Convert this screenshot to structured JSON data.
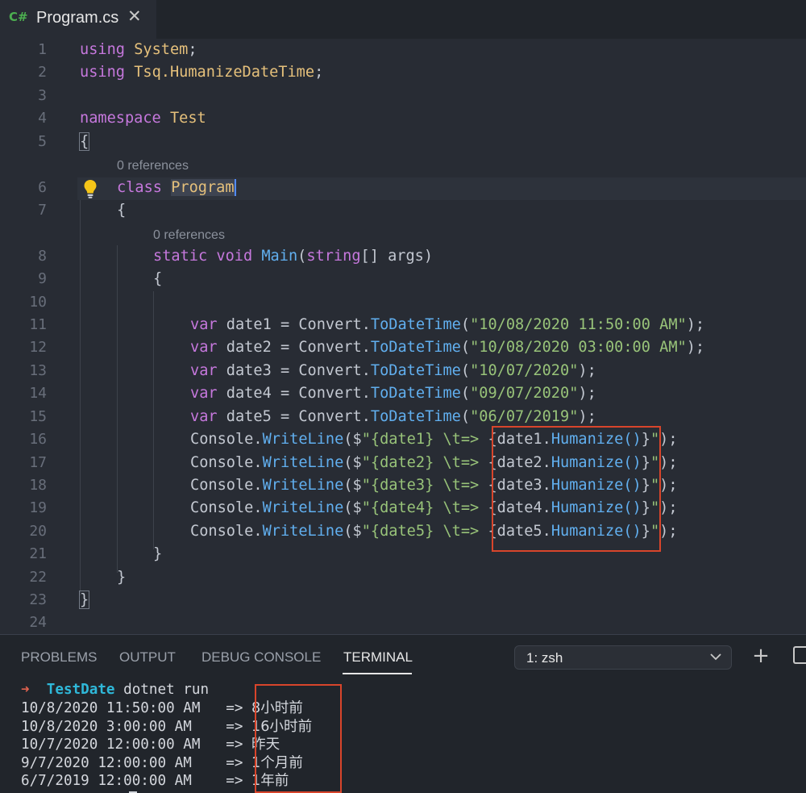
{
  "tab": {
    "icon": "C#",
    "title": "Program.cs"
  },
  "editor": {
    "codelens1": "0 references",
    "codelens2": "0 references",
    "line_numbers": [
      "1",
      "2",
      "3",
      "4",
      "5",
      "6",
      "7",
      "8",
      "9",
      "10",
      "11",
      "12",
      "13",
      "14",
      "15",
      "16",
      "17",
      "18",
      "19",
      "20",
      "21",
      "22",
      "23",
      "24"
    ],
    "code": {
      "l1": {
        "kw": "using",
        "ns": "System",
        "end": ";"
      },
      "l2": {
        "kw": "using",
        "ns": "Tsq.HumanizeDateTime",
        "end": ";"
      },
      "l4": {
        "kw": "namespace",
        "ns": "Test"
      },
      "l5": "{",
      "l6": {
        "kw": "class",
        "name": "Program"
      },
      "l7": "{",
      "l8": {
        "kw": "static",
        "kw2": "void",
        "fn": "Main",
        "p1": "(",
        "type": "string",
        "rest": "[] args)"
      },
      "l9": "{",
      "vars": [
        {
          "kw": "var",
          "name": " date1 = Convert.",
          "fn": "ToDateTime",
          "str": "\"10/08/2020 11:50:00 AM\"",
          "end": ");"
        },
        {
          "kw": "var",
          "name": " date2 = Convert.",
          "fn": "ToDateTime",
          "str": "\"10/08/2020 03:00:00 AM\"",
          "end": ");"
        },
        {
          "kw": "var",
          "name": " date3 = Convert.",
          "fn": "ToDateTime",
          "str": "\"10/07/2020\"",
          "end": ");"
        },
        {
          "kw": "var",
          "name": " date4 = Convert.",
          "fn": "ToDateTime",
          "str": "\"09/07/2020\"",
          "end": ");"
        },
        {
          "kw": "var",
          "name": " date5 = Convert.",
          "fn": "ToDateTime",
          "str": "\"06/07/2019\"",
          "end": ");"
        }
      ],
      "writes": [
        {
          "obj": "Console.",
          "fn": "WriteLine",
          "open": "($",
          "s1": "\"{date1} \\t=> ",
          "arg": "{date1.",
          "call": "Humanize()",
          "close": "}",
          "s2": "\"",
          "end": ");"
        },
        {
          "obj": "Console.",
          "fn": "WriteLine",
          "open": "($",
          "s1": "\"{date2} \\t=> ",
          "arg": "{date2.",
          "call": "Humanize()",
          "close": "}",
          "s2": "\"",
          "end": ");"
        },
        {
          "obj": "Console.",
          "fn": "WriteLine",
          "open": "($",
          "s1": "\"{date3} \\t=> ",
          "arg": "{date3.",
          "call": "Humanize()",
          "close": "}",
          "s2": "\"",
          "end": ");"
        },
        {
          "obj": "Console.",
          "fn": "WriteLine",
          "open": "($",
          "s1": "\"{date4} \\t=> ",
          "arg": "{date4.",
          "call": "Humanize()",
          "close": "}",
          "s2": "\"",
          "end": ");"
        },
        {
          "obj": "Console.",
          "fn": "WriteLine",
          "open": "($",
          "s1": "\"{date5} \\t=> ",
          "arg": "{date5.",
          "call": "Humanize()",
          "close": "}",
          "s2": "\"",
          "end": ");"
        }
      ],
      "l21": "}",
      "l22": "}",
      "l23": "}"
    }
  },
  "panel": {
    "tabs": [
      "PROBLEMS",
      "OUTPUT",
      "DEBUG CONSOLE",
      "TERMINAL"
    ],
    "terminal_select": "1: zsh",
    "prompt": {
      "arrow": "➜",
      "dir": "TestDate",
      "command": "dotnet run"
    },
    "output": [
      {
        "date": "10/8/2020 11:50:00 AM",
        "arrow": "=>",
        "result": "8小时前"
      },
      {
        "date": "10/8/2020 3:00:00 AM",
        "arrow": "=>",
        "result": "16小时前"
      },
      {
        "date": "10/7/2020 12:00:00 AM",
        "arrow": "=>",
        "result": "昨天"
      },
      {
        "date": "9/7/2020 12:00:00 AM",
        "arrow": "=>",
        "result": "1个月前"
      },
      {
        "date": "6/7/2019 12:00:00 AM",
        "arrow": "=>",
        "result": "1年前"
      }
    ]
  }
}
